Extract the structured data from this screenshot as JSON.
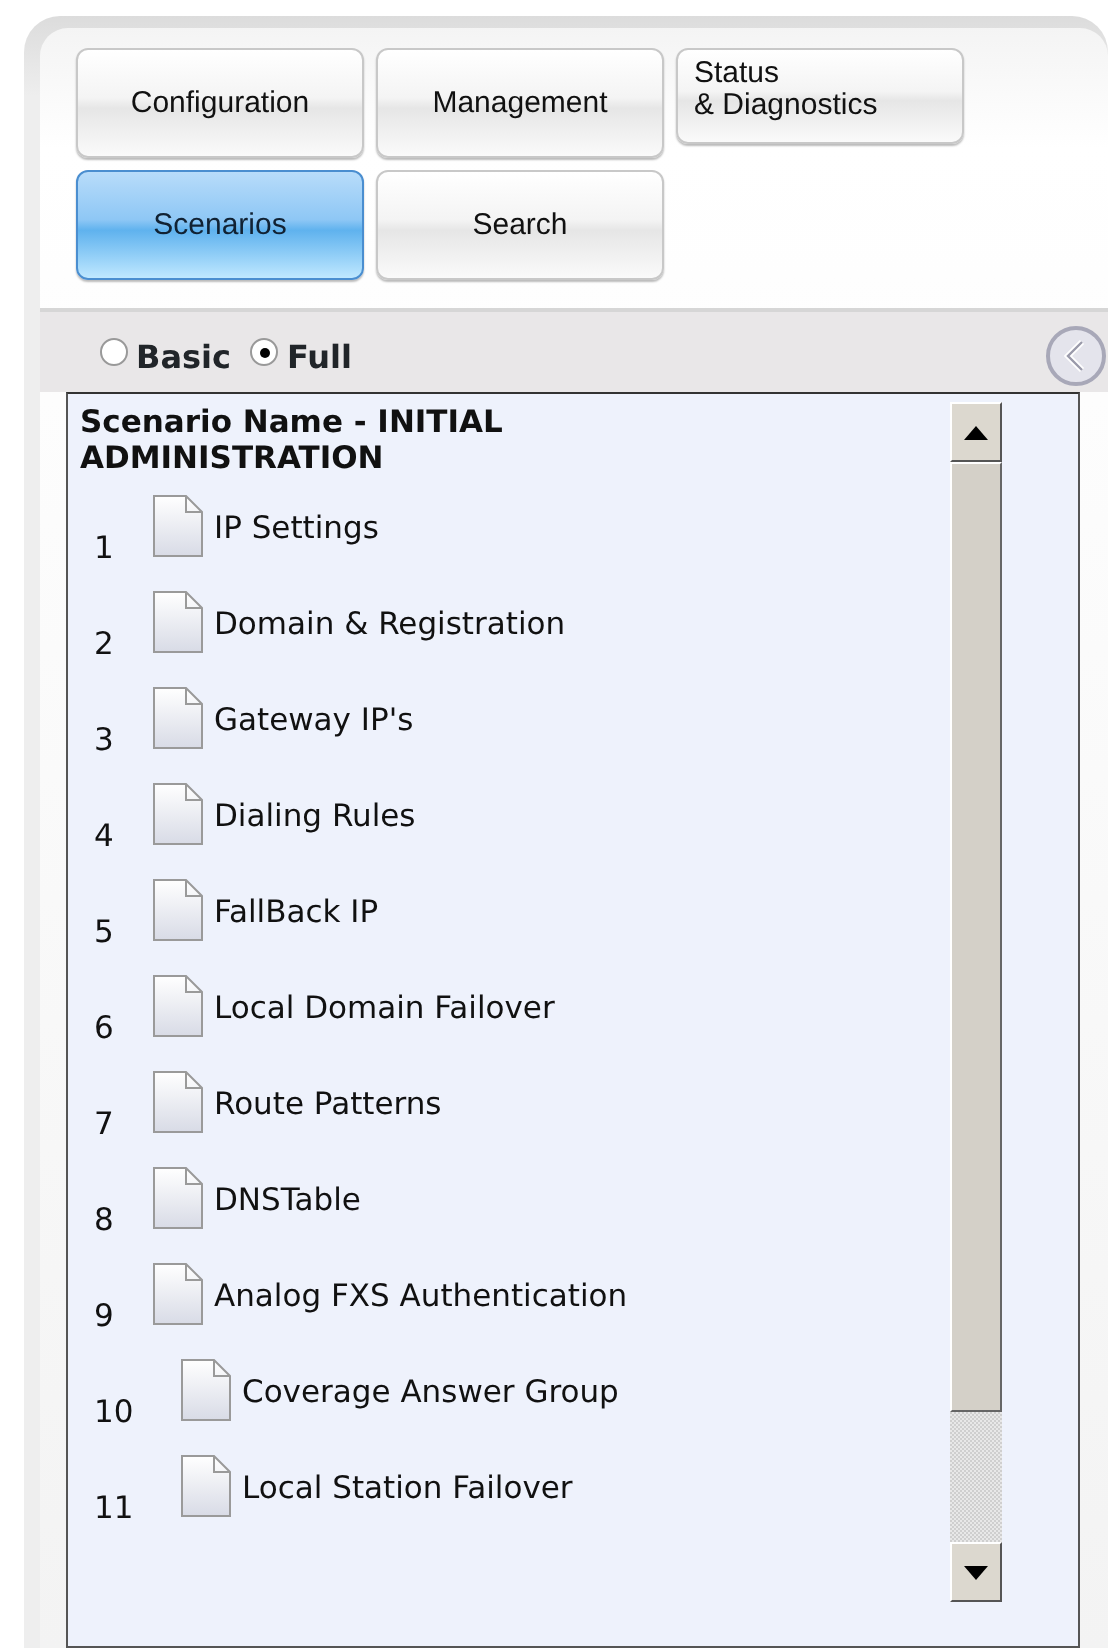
{
  "nav_buttons": [
    {
      "label": "Configuration",
      "selected": false
    },
    {
      "label": "Management",
      "selected": false
    },
    {
      "label": "Status\n& Diagnostics",
      "selected": false
    },
    {
      "label": "Scenarios",
      "selected": true
    },
    {
      "label": "Search",
      "selected": false
    }
  ],
  "view_mode": [
    {
      "label": "Basic",
      "selected": false
    },
    {
      "label": "Full",
      "selected": true
    }
  ],
  "scenario": {
    "title": "Scenario Name - INITIAL ADMINISTRATION",
    "steps": [
      {
        "number": "1",
        "label": "IP Settings"
      },
      {
        "number": "2",
        "label": "Domain & Registration"
      },
      {
        "number": "3",
        "label": "Gateway IP's"
      },
      {
        "number": "4",
        "label": "Dialing Rules"
      },
      {
        "number": "5",
        "label": "FallBack IP"
      },
      {
        "number": "6",
        "label": "Local Domain Failover"
      },
      {
        "number": "7",
        "label": "Route Patterns"
      },
      {
        "number": "8",
        "label": "DNSTable"
      },
      {
        "number": "9",
        "label": "Analog FXS Authentication"
      },
      {
        "number": "10",
        "label": "Coverage Answer Group"
      },
      {
        "number": "11",
        "label": "Local Station Failover"
      }
    ]
  }
}
